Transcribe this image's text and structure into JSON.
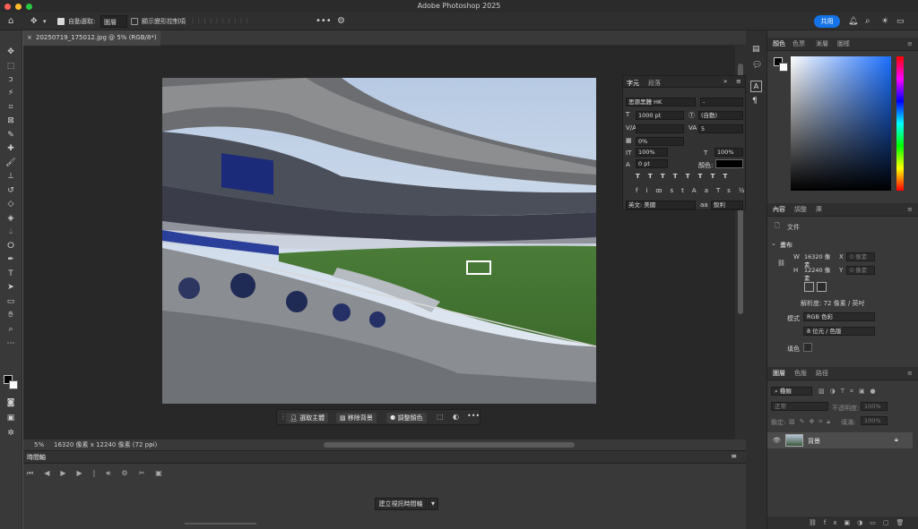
{
  "app": {
    "title": "Adobe Photoshop 2025"
  },
  "options_bar": {
    "auto_select_label": "自動選取:",
    "auto_select_target": "圖層",
    "show_transform_label": "顯示變形控制項",
    "share_button": "共用"
  },
  "document": {
    "tab_title": "20250719_175012.jpg @ 5% (RGB/8*)",
    "zoom": "5%",
    "status_info": "16320 像素 x 12240 像素 (72 ppi)"
  },
  "context_bar": {
    "select_subject": "選取主體",
    "remove_background": "移除背景",
    "adjust_color": "調整顏色"
  },
  "character_panel": {
    "tabs": [
      "字元",
      "段落"
    ],
    "font_family": "思源黑體 HK",
    "font_style": "-",
    "font_size": "1000 pt",
    "leading": "(自動)",
    "kerning": "",
    "tracking": "5",
    "vertical_scale_pct": "0%",
    "h_scale": "100%",
    "v_scale": "100%",
    "baseline_shift": "0 pt",
    "color_label": "顏色:",
    "style_buttons": [
      "T",
      "T",
      "TT",
      "Tr",
      "T'",
      "T,",
      "T",
      "T"
    ],
    "glyph_buttons": [
      "fi",
      "ꝏ",
      "st",
      "A",
      "ad",
      "T",
      "1st",
      "½"
    ],
    "language": "英文: 美國",
    "antialias": "銳利"
  },
  "color_panel": {
    "tabs": [
      "顏色",
      "色票",
      "漸層",
      "圖樣"
    ]
  },
  "properties_panel": {
    "tabs": [
      "內容",
      "調整",
      "庫"
    ],
    "doc_label": "文件",
    "canvas_label": "畫布",
    "w_label": "W",
    "w_value": "16320 像素",
    "x_label": "X",
    "x_value": "0 像素",
    "h_label": "H",
    "h_value": "12240 像素",
    "y_label": "Y",
    "y_value": "0 像素",
    "resolution": "解析度: 72 像素 / 英吋",
    "mode_label": "模式",
    "mode_value": "RGB 色彩",
    "bits_value": "8 位元 / 色版",
    "fill_label": "填色"
  },
  "layers_panel": {
    "tabs": [
      "圖層",
      "色版",
      "路徑"
    ],
    "filter_label": "種類",
    "blend_mode": "正常",
    "opacity_label": "不透明度:",
    "opacity_value": "100%",
    "lock_label": "鎖定:",
    "fill_label": "填滿:",
    "fill_value": "100%",
    "layers": [
      {
        "name": "背景"
      }
    ]
  },
  "timeline": {
    "title": "時間軸",
    "create_button": "建立視訊時間軸"
  },
  "colors": {
    "accent": "#1473e6",
    "panel_bg": "#393939",
    "canvas_bg": "#282828"
  }
}
